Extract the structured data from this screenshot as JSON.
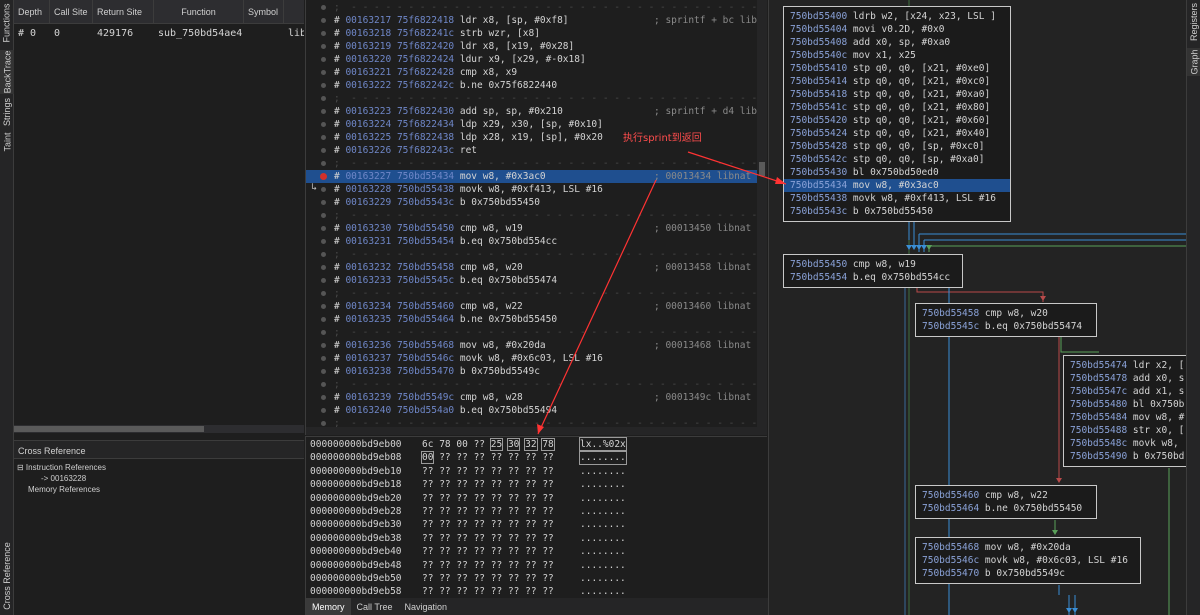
{
  "left_tabs": [
    "Functions",
    "BackTrace",
    "Strings",
    "Taint",
    "Cross Reference"
  ],
  "right_tabs": [
    "Registers",
    "Graph"
  ],
  "backtrace": {
    "headers": [
      "Depth",
      "Call Site",
      "Return Site",
      "Function",
      "Symbol"
    ],
    "rows": [
      [
        "# 0",
        "0",
        "429176",
        "sub_750bd54ae4",
        "libna"
      ]
    ]
  },
  "xref": {
    "title": "Cross Reference",
    "items": [
      "⊟ Instruction References",
      "-> 00163228",
      "Memory References"
    ]
  },
  "disasm": {
    "lines": [
      {
        "t": "sep"
      },
      {
        "idx": "00163217",
        "addr": "75f6822418",
        "code": "ldr x8, [sp, #0xf8]",
        "cm": "; sprintf + bc lib"
      },
      {
        "idx": "00163218",
        "addr": "75f682241c",
        "code": "strb wzr, [x8]",
        "cm": ""
      },
      {
        "idx": "00163219",
        "addr": "75f6822420",
        "code": "ldr x8, [x19, #0x28]",
        "cm": ""
      },
      {
        "idx": "00163220",
        "addr": "75f6822424",
        "code": "ldur x9, [x29, #-0x18]",
        "cm": ""
      },
      {
        "idx": "00163221",
        "addr": "75f6822428",
        "code": "cmp x8, x9",
        "cm": ""
      },
      {
        "idx": "00163222",
        "addr": "75f682242c",
        "code": "b.ne 0x75f6822440",
        "cm": ""
      },
      {
        "t": "sep"
      },
      {
        "idx": "00163223",
        "addr": "75f6822430",
        "code": "add sp, sp, #0x210",
        "cm": "; sprintf + d4 lib"
      },
      {
        "idx": "00163224",
        "addr": "75f6822434",
        "code": "ldp x29, x30, [sp, #0x10]",
        "cm": ""
      },
      {
        "idx": "00163225",
        "addr": "75f6822438",
        "code": "ldp x28, x19, [sp], #0x20",
        "cm": ""
      },
      {
        "idx": "00163226",
        "addr": "75f682243c",
        "code": "ret",
        "cm": ""
      },
      {
        "t": "sep"
      },
      {
        "idx": "00163227",
        "addr": "750bd55434",
        "code": "mov w8, #0x3ac0",
        "cm": "; 00013434 libnat",
        "selected": true
      },
      {
        "idx": "00163228",
        "addr": "750bd55438",
        "code": "movk w8, #0xf413, LSL #16",
        "cm": ""
      },
      {
        "idx": "00163229",
        "addr": "750bd5543c",
        "code": "b 0x750bd55450",
        "cm": ""
      },
      {
        "t": "sep"
      },
      {
        "idx": "00163230",
        "addr": "750bd55450",
        "code": "cmp w8, w19",
        "cm": "; 00013450 libnat"
      },
      {
        "idx": "00163231",
        "addr": "750bd55454",
        "code": "b.eq 0x750bd554cc",
        "cm": ""
      },
      {
        "t": "sep"
      },
      {
        "idx": "00163232",
        "addr": "750bd55458",
        "code": "cmp w8, w20",
        "cm": "; 00013458 libnat"
      },
      {
        "idx": "00163233",
        "addr": "750bd5545c",
        "code": "b.eq 0x750bd55474",
        "cm": ""
      },
      {
        "t": "sep"
      },
      {
        "idx": "00163234",
        "addr": "750bd55460",
        "code": "cmp w8, w22",
        "cm": "; 00013460 libnat"
      },
      {
        "idx": "00163235",
        "addr": "750bd55464",
        "code": "b.ne 0x750bd55450",
        "cm": ""
      },
      {
        "t": "sep"
      },
      {
        "idx": "00163236",
        "addr": "750bd55468",
        "code": "mov w8, #0x20da",
        "cm": "; 00013468 libnat"
      },
      {
        "idx": "00163237",
        "addr": "750bd5546c",
        "code": "movk w8, #0x6c03, LSL #16",
        "cm": ""
      },
      {
        "idx": "00163238",
        "addr": "750bd55470",
        "code": "b 0x750bd5549c",
        "cm": ""
      },
      {
        "t": "sep"
      },
      {
        "idx": "00163239",
        "addr": "750bd5549c",
        "code": "cmp w8, w28",
        "cm": "; 0001349c libnat"
      },
      {
        "idx": "00163240",
        "addr": "750bd554a0",
        "code": "b.eq 0x750bd55494",
        "cm": ""
      },
      {
        "t": "sep"
      }
    ]
  },
  "annotation": "执行sprint到返回",
  "memory": {
    "rows": [
      {
        "addr": "000000000bd9eb00",
        "bytes": "6c 78 00 ?? 25 30 32 78",
        "ascii": "lx..%02x"
      },
      {
        "addr": "000000000bd9eb08",
        "bytes": "00 ?? ?? ?? ?? ?? ?? ??",
        "ascii": "........"
      },
      {
        "addr": "000000000bd9eb10",
        "bytes": "?? ?? ?? ?? ?? ?? ?? ??",
        "ascii": "........"
      },
      {
        "addr": "000000000bd9eb18",
        "bytes": "?? ?? ?? ?? ?? ?? ?? ??",
        "ascii": "........"
      },
      {
        "addr": "000000000bd9eb20",
        "bytes": "?? ?? ?? ?? ?? ?? ?? ??",
        "ascii": "........"
      },
      {
        "addr": "000000000bd9eb28",
        "bytes": "?? ?? ?? ?? ?? ?? ?? ??",
        "ascii": "........"
      },
      {
        "addr": "000000000bd9eb30",
        "bytes": "?? ?? ?? ?? ?? ?? ?? ??",
        "ascii": "........"
      },
      {
        "addr": "000000000bd9eb38",
        "bytes": "?? ?? ?? ?? ?? ?? ?? ??",
        "ascii": "........"
      },
      {
        "addr": "000000000bd9eb40",
        "bytes": "?? ?? ?? ?? ?? ?? ?? ??",
        "ascii": "........"
      },
      {
        "addr": "000000000bd9eb48",
        "bytes": "?? ?? ?? ?? ?? ?? ?? ??",
        "ascii": "........"
      },
      {
        "addr": "000000000bd9eb50",
        "bytes": "?? ?? ?? ?? ?? ?? ?? ??",
        "ascii": "........"
      },
      {
        "addr": "000000000bd9eb58",
        "bytes": "?? ?? ?? ?? ?? ?? ?? ??",
        "ascii": "........"
      }
    ],
    "tabs": [
      "Memory",
      "Call Tree",
      "Navigation"
    ]
  },
  "graph": {
    "blocks": [
      {
        "lines": [
          [
            "750bd55400",
            "ldrb w2, [x24, x23, LSL ]"
          ],
          [
            "750bd55404",
            "movi v0.2D, #0x0"
          ],
          [
            "750bd55408",
            "add x0, sp, #0xa0"
          ],
          [
            "750bd5540c",
            "mov x1, x25"
          ],
          [
            "750bd55410",
            "stp q0, q0, [x21, #0xe0]"
          ],
          [
            "750bd55414",
            "stp q0, q0, [x21, #0xc0]"
          ],
          [
            "750bd55418",
            "stp q0, q0, [x21, #0xa0]"
          ],
          [
            "750bd5541c",
            "stp q0, q0, [x21, #0x80]"
          ],
          [
            "750bd55420",
            "stp q0, q0, [x21, #0x60]"
          ],
          [
            "750bd55424",
            "stp q0, q0, [x21, #0x40]"
          ],
          [
            "750bd55428",
            "stp q0, q0, [sp, #0xc0]"
          ],
          [
            "750bd5542c",
            "stp q0, q0, [sp, #0xa0]"
          ],
          [
            "750bd55430",
            "bl 0x750bd50ed0"
          ],
          [
            "750bd55434",
            "mov w8, #0x3ac0"
          ],
          [
            "750bd55438",
            "movk w8, #0xf413, LSL #16"
          ],
          [
            "750bd5543c",
            "b 0x750bd55450"
          ]
        ],
        "hilite": 13
      },
      {
        "lines": [
          [
            "750bd55450",
            "cmp w8, w19"
          ],
          [
            "750bd55454",
            "b.eq 0x750bd554cc"
          ]
        ]
      },
      {
        "lines": [
          [
            "750bd55458",
            "cmp w8, w20"
          ],
          [
            "750bd5545c",
            "b.eq 0x750bd55474"
          ]
        ]
      },
      {
        "lines": [
          [
            "750bd55474",
            "ldr x2, ["
          ],
          [
            "750bd55478",
            "add x0, s"
          ],
          [
            "750bd5547c",
            "add x1, s"
          ],
          [
            "750bd55480",
            "bl 0x750b"
          ],
          [
            "750bd55484",
            "mov w8, #"
          ],
          [
            "750bd55488",
            "str x0, ["
          ],
          [
            "750bd5548c",
            "movk w8, "
          ],
          [
            "750bd55490",
            "b 0x750bd"
          ]
        ]
      },
      {
        "lines": [
          [
            "750bd55460",
            "cmp w8, w22"
          ],
          [
            "750bd55464",
            "b.ne 0x750bd55450"
          ]
        ]
      },
      {
        "lines": [
          [
            "750bd55468",
            "mov w8, #0x20da"
          ],
          [
            "750bd5546c",
            "movk w8, #0x6c03, LSL #16"
          ],
          [
            "750bd55470",
            "b 0x750bd5549c"
          ]
        ]
      }
    ]
  },
  "colors": {
    "accent_selection": "#1f4f8f",
    "breakpoint": "#d0302b",
    "annotation_red": "#ff4d4d",
    "edge_green": "#5aa05a",
    "edge_red": "#b84a4a",
    "edge_blue": "#3a8ed6"
  }
}
